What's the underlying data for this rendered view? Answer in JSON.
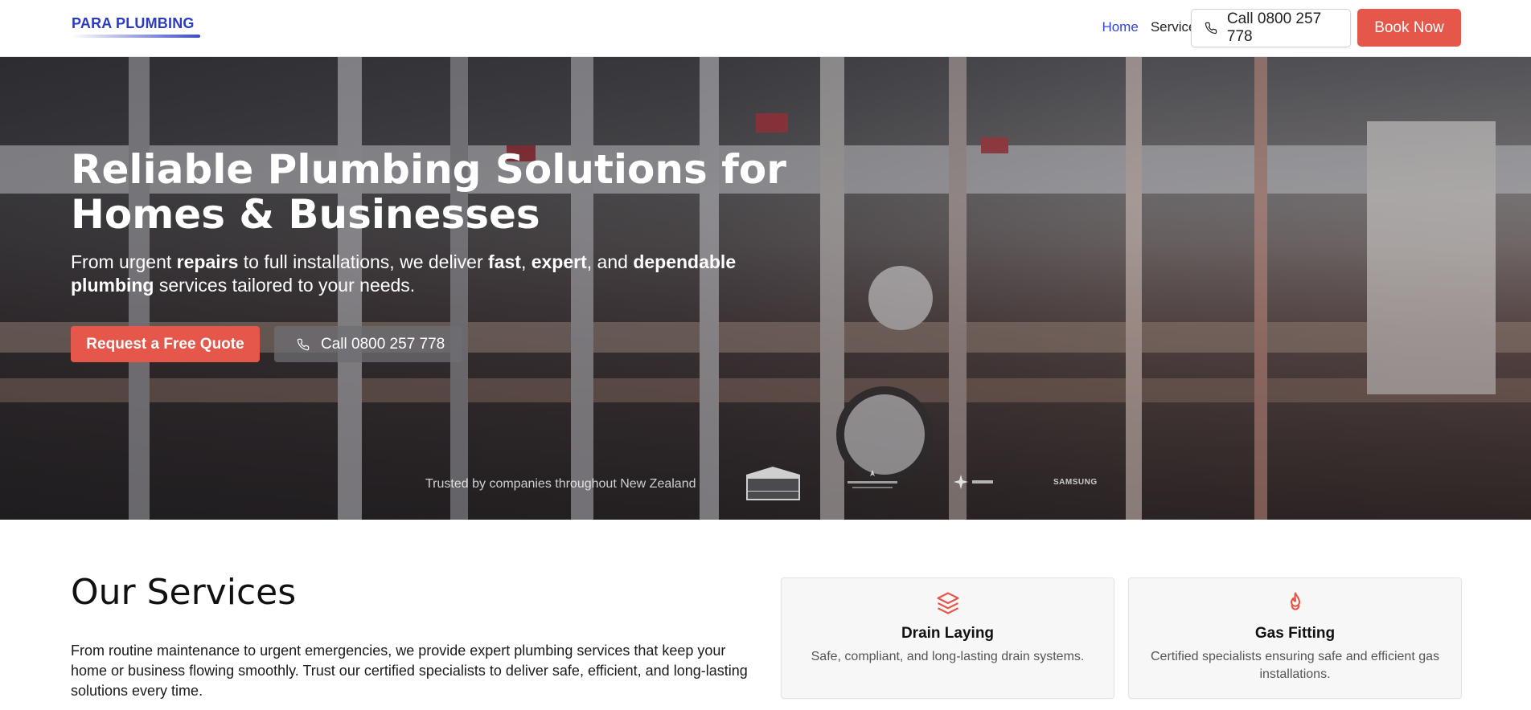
{
  "brand": {
    "name": "PARA PLUMBING",
    "accent": "#2b3bbd",
    "cta_color": "#e4574a"
  },
  "nav": {
    "items": [
      {
        "label": "Home",
        "active": true
      },
      {
        "label": "Services",
        "active": false
      }
    ],
    "call_label": "Call 0800 257 778",
    "book_label": "Book Now"
  },
  "hero": {
    "title": "Reliable Plumbing Solutions for Homes & Businesses",
    "subtitle_parts": {
      "p1": "From urgent ",
      "b1": "repairs",
      "p2": " to full installations, we deliver ",
      "b2": "fast",
      "p3": ", ",
      "b3": "expert",
      "p4": ", and ",
      "b4": "dependable plumbing",
      "p5": " services tailored to your needs."
    },
    "quote_button": "Request a Free Quote",
    "call_button": "Call 0800 257 778",
    "trusted_text": "Trusted by companies throughout New Zealand",
    "partner_logos": [
      "CHEMIST WAREHOUSE",
      "AIR NEW ZEALAND",
      "Spark",
      "SAMSUNG"
    ]
  },
  "services": {
    "title": "Our Services",
    "description": "From routine maintenance to urgent emergencies, we provide expert plumbing services that keep your home or business flowing smoothly. Trust our certified specialists to deliver safe, efficient, and long-lasting solutions every time.",
    "cards": [
      {
        "icon": "layers-icon",
        "title": "Drain Laying",
        "description": "Safe, compliant, and long-lasting drain systems."
      },
      {
        "icon": "flame-icon",
        "title": "Gas Fitting",
        "description": "Certified specialists ensuring safe and efficient gas installations."
      }
    ]
  }
}
